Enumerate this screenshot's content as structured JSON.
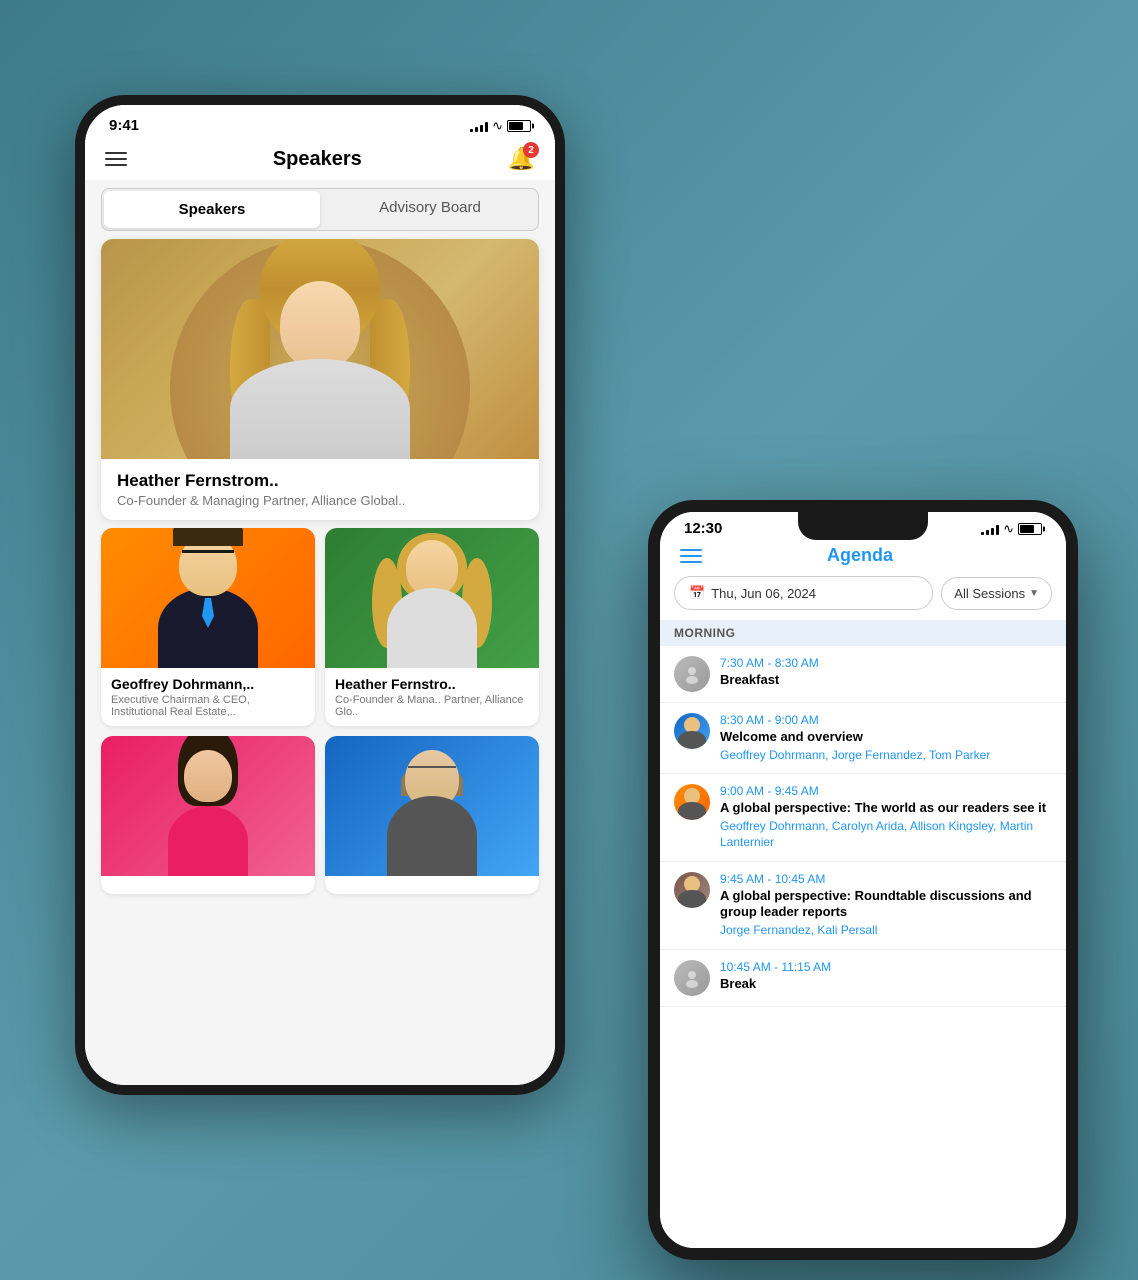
{
  "back_phone": {
    "status": {
      "time": "9:41",
      "signal_bars": 4,
      "wifi": true,
      "battery": 70
    },
    "app_bar": {
      "title": "Speakers",
      "notification_count": "2"
    },
    "tabs": [
      {
        "id": "speakers",
        "label": "Speakers",
        "active": true
      },
      {
        "id": "advisory",
        "label": "Advisory Board",
        "active": false
      }
    ],
    "featured_speaker": {
      "name": "Heather Fernstrom..",
      "title": "Co-Founder & Managing Partner, Alliance Global.."
    },
    "grid_speakers": [
      {
        "name": "Geoffrey Dohrmann,..",
        "title": "Executive Chairman & CEO, Institutional Real Estate,..",
        "bg": "orange"
      },
      {
        "name": "Heather Fernstro..",
        "title": "Co-Founder & Mana.. Partner, Alliance Glo..",
        "bg": "green"
      },
      {
        "name": "",
        "title": "",
        "bg": "pink"
      },
      {
        "name": "",
        "title": "",
        "bg": "blue"
      }
    ]
  },
  "front_phone": {
    "status": {
      "time": "12:30",
      "signal_bars": 4,
      "wifi": true,
      "battery": 70
    },
    "app_bar": {
      "title": "Agenda",
      "hamburger": true
    },
    "filters": {
      "date_label": "Thu, Jun 06, 2024",
      "sessions_label": "All Sessions",
      "calendar_icon": "📅"
    },
    "morning_section": {
      "label": "MORNING",
      "items": [
        {
          "time": "7:30 AM - 8:30 AM",
          "title": "Breakfast",
          "speakers": "",
          "avatar": "gray"
        },
        {
          "time": "8:30 AM - 9:00 AM",
          "title": "Welcome and overview",
          "speakers": "Geoffrey Dohrmann, Jorge Fernandez, Tom Parker",
          "avatar": "blue"
        },
        {
          "time": "9:00 AM - 9:45 AM",
          "title": "A global perspective: The world as our readers see it",
          "speakers": "Geoffrey Dohrmann, Carolyn Arida, Allison Kingsley, Martin Lanternier",
          "avatar": "orange"
        },
        {
          "time": "9:45 AM - 10:45 AM",
          "title": "A global perspective: Roundtable discussions and group leader reports",
          "speakers": "Jorge Fernandez, Kali Persall",
          "avatar": "brown"
        },
        {
          "time": "10:45 AM - 11:15 AM",
          "title": "Break",
          "speakers": "",
          "avatar": "gray"
        }
      ]
    }
  }
}
